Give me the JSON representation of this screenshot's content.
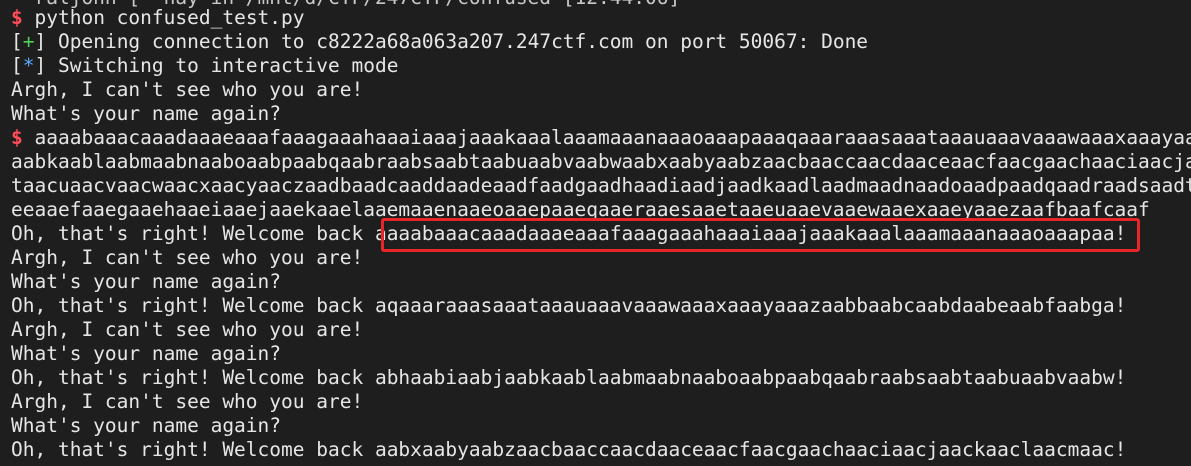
{
  "terminal": {
    "top_cutoff": "* raljohn [~ nay in /mnt/d/CTF/247CTF/confused [12:44:06]",
    "command_prompt": "$",
    "command": "python confused_test.py",
    "lines": [
      {
        "prefix": "[+]",
        "text": " Opening connection to c8222a68a063a207.247ctf.com on port 50067: Done"
      },
      {
        "prefix": "[*]",
        "text": " Switching to interactive mode"
      }
    ],
    "argh": "Argh, I can't see who you are!",
    "name_again": "What's your name again?",
    "input_prompt": "$",
    "input_line1": "aaaabaaacaaadaaaeaaafaaagaaahaaaiaaajaaakaaalaaamaaanaaaoaaapaaaqaaaraaasaaataaauaaavaaawaaaxaaayaaazaabbaabcaabdaabeaabfaabgaabhaabiaabjaa",
    "input_line2": "aabkaablaabmaabnaaboaabpaabqaabraabsaabtaabuaabvaabwaabxaabyaabzaacbaaccaacdaaceaacfaacgaachaaciaacjaackaaclaacmaacnaacoaacpaacqaacraacsaac",
    "input_line3": "taacuaacvaacwaacxaacyaaczaadbaadcaaddaadeaadfaadgaadhaadiaadjaadkaadlaadmaadnaadoaadpaadqaadraadsaadtaaduaadvaadwaadxaadyaadzaaebaaecaaedaa",
    "input_line4": "eeaaefaaegaaehaaeiaaejaaekaaelaaemaaenaaeoaaepaaeqaaeraaesaaetaaeuaaevaaewaaexaaeyaaezaafbaafcaaf",
    "welcome_prefix": "Oh, that's right! Welcome back ",
    "responses": [
      "aaaabaaacaaadaaaeaaafaaagaaahaaaiaaajaaakaaalaaamaaanaaaoaaapaa",
      "aqaaaraaasaaataaauaaavaaawaaaxaaayaaazaabbaabcaabdaabeaabfaabga",
      "abhaabiaabjaabkaablaabmaabnaaboaabpaabqaabraabsaabtaabuaabvaabw",
      "aabxaabyaabzaacbaaccaacdaaceaacfaacgaachaaciaacjaackaaclaacmaac"
    ],
    "exclaim": "!"
  },
  "colors": {
    "background": "#1e1e1e",
    "text": "#e6e6e6",
    "prompt": "#ff4d5a",
    "plus": "#4fd25a",
    "star": "#5aa9ff",
    "highlight_border": "#e8262a"
  }
}
